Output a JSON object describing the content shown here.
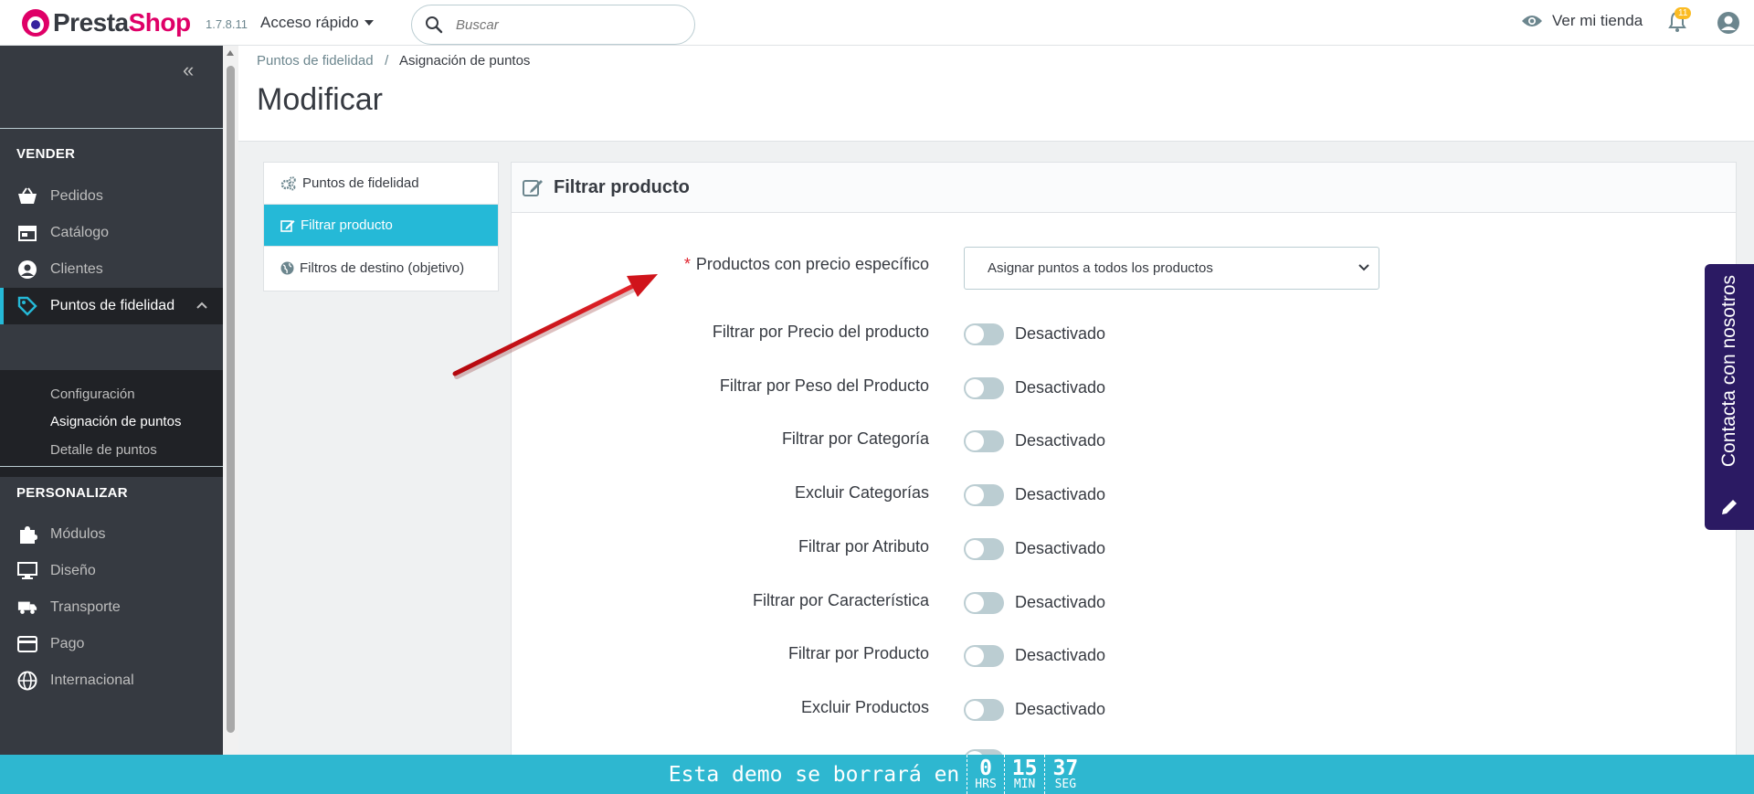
{
  "header": {
    "brand_part1": "Presta",
    "brand_part2": "Shop",
    "version": "1.7.8.11",
    "quick_access": "Acceso rápido",
    "search_placeholder": "Buscar",
    "view_store": "Ver mi tienda",
    "notifications_count": "11"
  },
  "sidebar": {
    "section_sell": "VENDER",
    "items_sell": [
      {
        "label": "Pedidos",
        "icon": "basket-icon"
      },
      {
        "label": "Catálogo",
        "icon": "store-icon"
      },
      {
        "label": "Clientes",
        "icon": "user-circle-icon"
      },
      {
        "label": "Puntos de fidelidad",
        "icon": "tag-icon"
      }
    ],
    "submenu": [
      "Configuración",
      "Asignación de puntos",
      "Detalle de puntos"
    ],
    "section_customize": "PERSONALIZAR",
    "items_customize": [
      {
        "label": "Módulos",
        "icon": "puzzle-icon"
      },
      {
        "label": "Diseño",
        "icon": "monitor-icon"
      },
      {
        "label": "Transporte",
        "icon": "truck-icon"
      },
      {
        "label": "Pago",
        "icon": "card-icon"
      },
      {
        "label": "Internacional",
        "icon": "globe-icon"
      }
    ]
  },
  "breadcrumb": {
    "parent": "Puntos de fidelidad",
    "separator": "/",
    "current": "Asignación de puntos"
  },
  "page_title": "Modificar",
  "tabs": [
    {
      "label": "Puntos de fidelidad",
      "icon": "cogs-icon"
    },
    {
      "label": "Filtrar producto",
      "icon": "edit-icon"
    },
    {
      "label": "Filtros de destino (objetivo)",
      "icon": "globe-icon"
    }
  ],
  "panel": {
    "title": "Filtrar producto",
    "required_mark": "*",
    "specific_price_label": "Productos con precio específico",
    "specific_price_value": "Asignar puntos a todos los productos",
    "filters": [
      {
        "label": "Filtrar por Precio del producto",
        "state": "Desactivado"
      },
      {
        "label": "Filtrar por Peso del Producto",
        "state": "Desactivado"
      },
      {
        "label": "Filtrar por Categoría",
        "state": "Desactivado"
      },
      {
        "label": "Excluir Categorías",
        "state": "Desactivado"
      },
      {
        "label": "Filtrar por Atributo",
        "state": "Desactivado"
      },
      {
        "label": "Filtrar por Característica",
        "state": "Desactivado"
      },
      {
        "label": "Filtrar por Producto",
        "state": "Desactivado"
      },
      {
        "label": "Excluir Productos",
        "state": "Desactivado"
      }
    ]
  },
  "contact_tab": "Contacta con nosotros",
  "demo_bar": {
    "text": "Esta demo se borrará en",
    "hours": "0",
    "hours_unit": "HRS",
    "minutes": "15",
    "minutes_unit": "MIN",
    "seconds": "37",
    "seconds_unit": "SEG"
  },
  "colors": {
    "accent": "#25b9d7",
    "sidebar": "#363a41",
    "brand": "#df0067",
    "contact": "#2b1a63",
    "arrow": "#d0141b"
  }
}
